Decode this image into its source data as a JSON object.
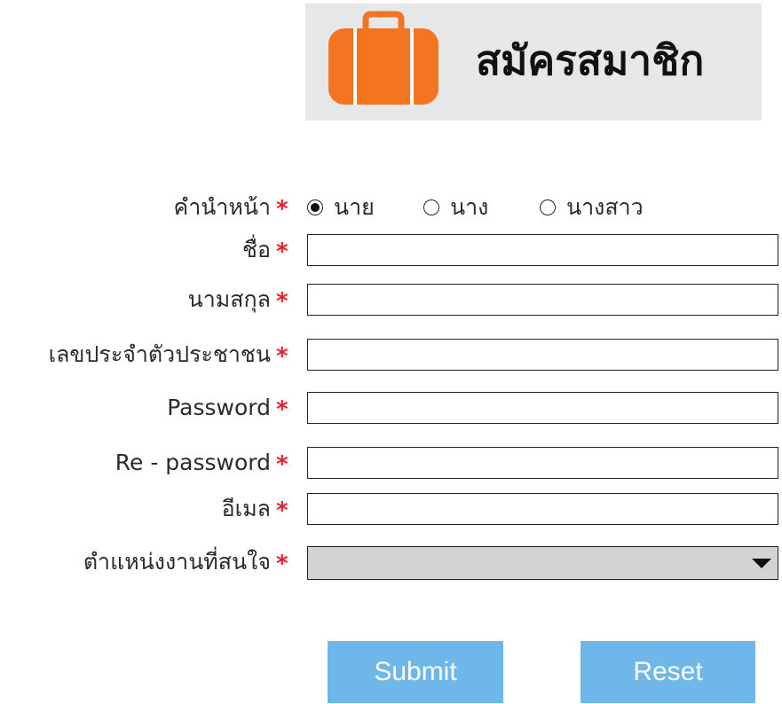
{
  "header": {
    "title": "สมัครสมาชิก",
    "icon": "suitcase-icon",
    "background": "#e6e7e8",
    "icon_color": "#f47521"
  },
  "required_marker": "*",
  "required_color": "#e8202a",
  "form": {
    "title_prefix": {
      "label": "คำนำหน้า",
      "options": [
        {
          "label": "นาย",
          "selected": true
        },
        {
          "label": "นาง",
          "selected": false
        },
        {
          "label": "นางสาว",
          "selected": false
        }
      ]
    },
    "first_name": {
      "label": "ชื่อ",
      "value": ""
    },
    "last_name": {
      "label": "นามสกุล",
      "value": ""
    },
    "national_id": {
      "label": "เลขประจำตัวประชาชน",
      "value": ""
    },
    "password": {
      "label": "Password",
      "value": ""
    },
    "re_password": {
      "label": "Re - password",
      "value": ""
    },
    "email": {
      "label": "อีเมล",
      "value": ""
    },
    "position": {
      "label": "ตำแหน่งงานที่สนใจ",
      "selected": ""
    }
  },
  "buttons": {
    "submit": "Submit",
    "reset": "Reset",
    "color": "#6fb7e9"
  }
}
